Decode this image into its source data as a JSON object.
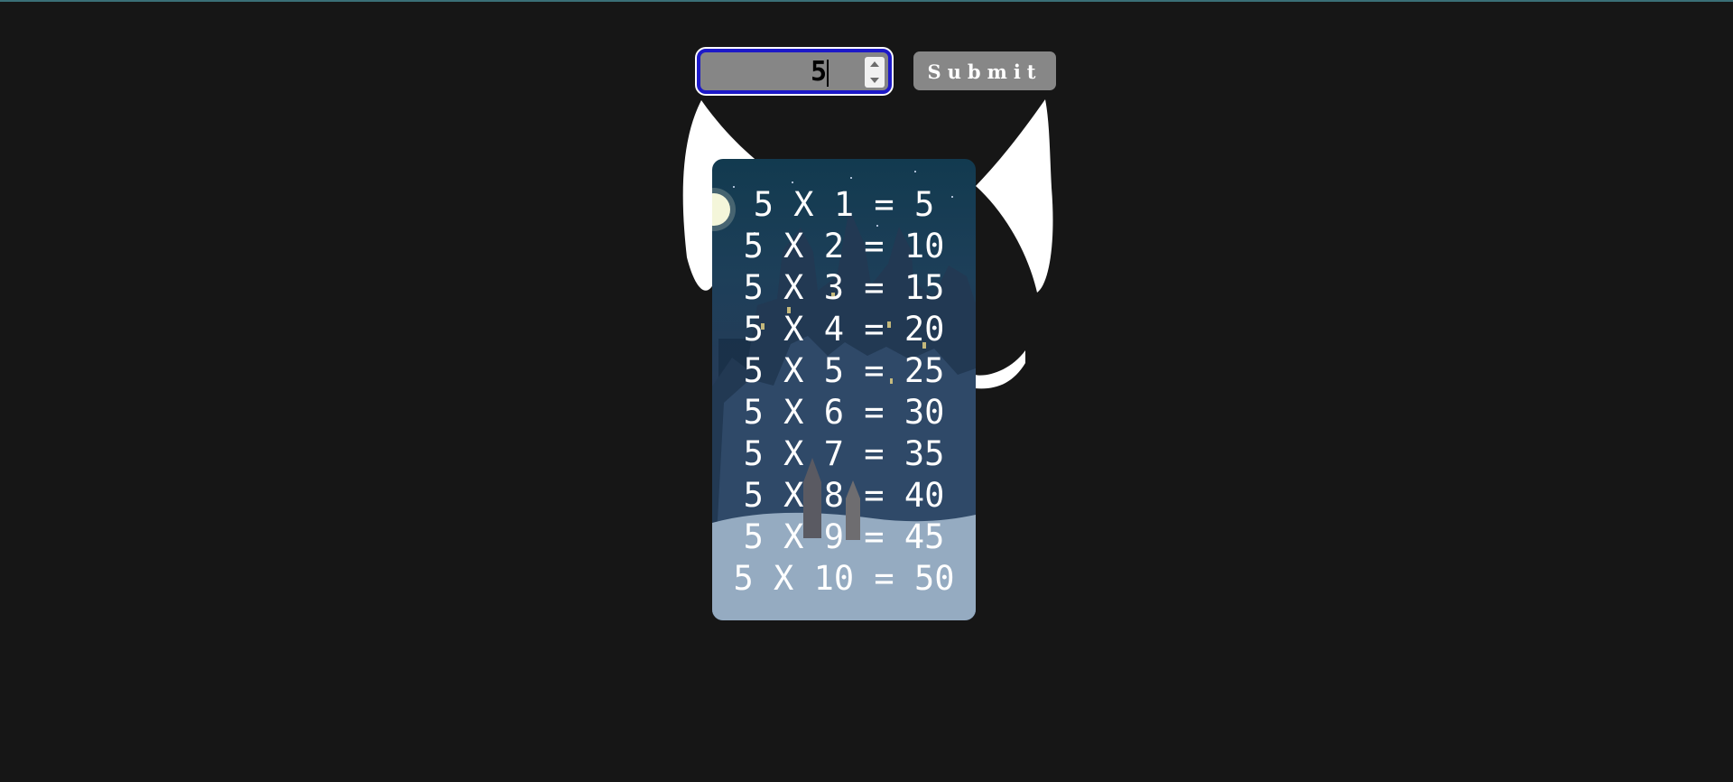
{
  "input": {
    "value": "5",
    "stepper_up_icon": "chevron-up-icon",
    "stepper_down_icon": "chevron-down-icon"
  },
  "submit": {
    "label": "Submit"
  },
  "table": {
    "lines": [
      "5 X 1 = 5",
      "5 X 2 = 10",
      "5 X 3 = 15",
      "5 X 4 = 20",
      "5 X 5 = 25",
      "5 X 6 = 30",
      "5 X 7 = 35",
      "5 X 8 = 40",
      "5 X 9 = 45",
      "5 X 10 = 50"
    ]
  },
  "colors": {
    "background": "#161616",
    "input_border": "#1d19c8",
    "input_fill": "#868686",
    "button_fill": "#878787",
    "table_text": "#ffffff"
  }
}
